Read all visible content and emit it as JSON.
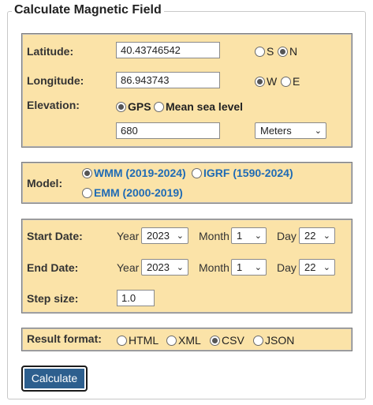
{
  "form": {
    "legend": "Calculate Magnetic Field",
    "location": {
      "latitude_label": "Latitude:",
      "latitude_value": "40.43746542",
      "lat_hemisphere": {
        "options": [
          "S",
          "N"
        ],
        "selected": "N"
      },
      "longitude_label": "Longitude:",
      "longitude_value": "86.943743",
      "lon_hemisphere": {
        "options": [
          "W",
          "E"
        ],
        "selected": "W"
      },
      "elevation_label": "Elevation:",
      "elevation_ref": {
        "options": [
          "GPS",
          "Mean sea level"
        ],
        "selected": "GPS"
      },
      "elevation_value": "680",
      "elevation_unit": "Meters"
    },
    "model": {
      "label": "Model:",
      "options": [
        "WMM (2019-2024)",
        "IGRF (1590-2024)",
        "EMM (2000-2019)"
      ],
      "selected": "WMM (2019-2024)"
    },
    "dates": {
      "start_label": "Start Date:",
      "end_label": "End Date:",
      "year_label": "Year",
      "month_label": "Month",
      "day_label": "Day",
      "start": {
        "year": "2023",
        "month": "1",
        "day": "22"
      },
      "end": {
        "year": "2023",
        "month": "1",
        "day": "22"
      },
      "step_label": "Step size:",
      "step_value": "1.0"
    },
    "result": {
      "label": "Result format:",
      "options": [
        "HTML",
        "XML",
        "CSV",
        "JSON"
      ],
      "selected": "CSV"
    },
    "submit_label": "Calculate"
  },
  "colors": {
    "panel_bg": "#fbe3a8",
    "link_blue": "#1f6bb5",
    "button_bg": "#2d5f8e"
  },
  "icons": {
    "select_arrow": "chevron-down-icon"
  }
}
